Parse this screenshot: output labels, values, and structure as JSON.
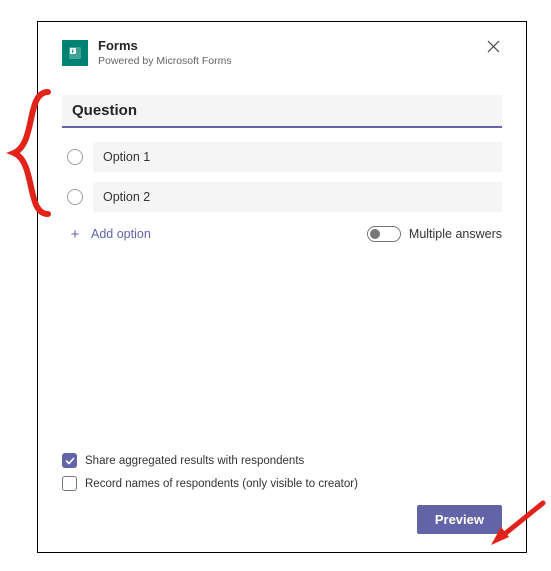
{
  "header": {
    "title": "Forms",
    "subtitle": "Powered by Microsoft Forms"
  },
  "question": {
    "placeholder": "Question",
    "value": ""
  },
  "options": [
    {
      "value": "Option 1"
    },
    {
      "value": "Option 2"
    }
  ],
  "controls": {
    "add_option_label": "Add option",
    "multiple_answers_label": "Multiple answers"
  },
  "settings": {
    "share_results": {
      "checked": true,
      "label": "Share aggregated results with respondents"
    },
    "record_names": {
      "checked": false,
      "label": "Record names of respondents (only visible to creator)"
    }
  },
  "footer": {
    "preview_label": "Preview"
  }
}
